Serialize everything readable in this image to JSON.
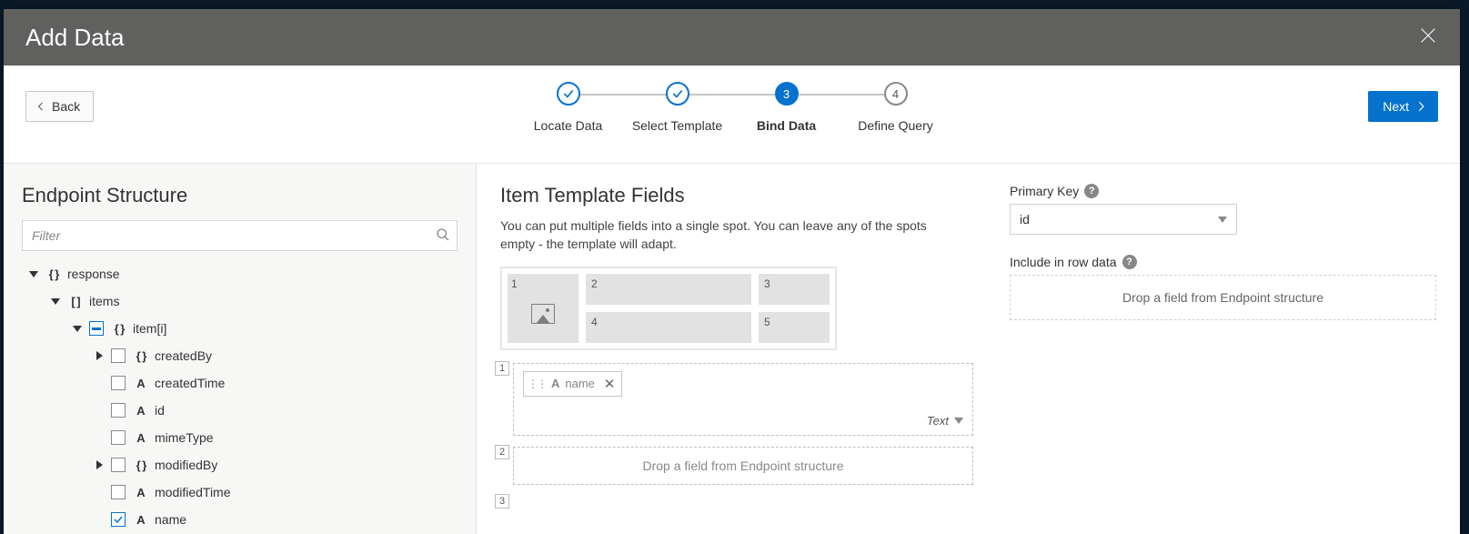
{
  "dialog": {
    "title": "Add Data"
  },
  "nav": {
    "back": "Back",
    "next": "Next"
  },
  "wizard": {
    "steps": [
      {
        "label": "Locate Data",
        "state": "done"
      },
      {
        "label": "Select Template",
        "state": "done"
      },
      {
        "label": "Bind Data",
        "state": "current",
        "num": "3"
      },
      {
        "label": "Define Query",
        "state": "future",
        "num": "4"
      }
    ]
  },
  "left": {
    "heading": "Endpoint Structure",
    "filter_placeholder": "Filter",
    "tree": {
      "response": "response",
      "items": "items",
      "item": "item[i]",
      "createdBy": "createdBy",
      "createdTime": "createdTime",
      "id": "id",
      "mimeType": "mimeType",
      "modifiedBy": "modifiedBy",
      "modifiedTime": "modifiedTime",
      "name": "name"
    }
  },
  "right": {
    "heading": "Item Template Fields",
    "desc": "You can put multiple fields into a single spot. You can leave any of the spots empty - the template will adapt.",
    "slot_nums": {
      "s1": "1",
      "s2": "2",
      "s3": "3",
      "s4": "4",
      "s5": "5"
    },
    "field1": {
      "num": "1",
      "tag": "name",
      "type_label": "Text"
    },
    "field2": {
      "num": "2",
      "placeholder": "Drop a field from Endpoint structure"
    },
    "field3": {
      "num": "3"
    },
    "side": {
      "pk_label": "Primary Key",
      "pk_value": "id",
      "row_label": "Include in row data",
      "row_placeholder": "Drop a field from Endpoint structure"
    }
  }
}
